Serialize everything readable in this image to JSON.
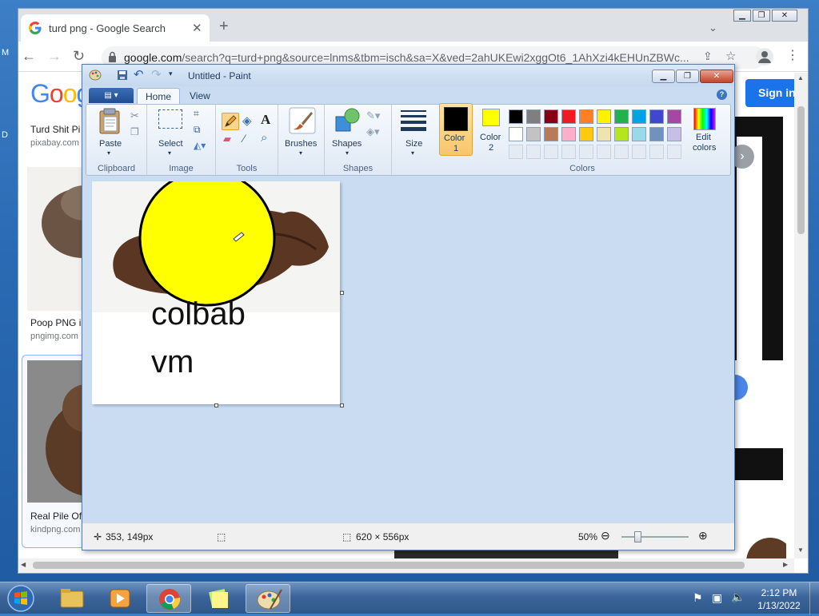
{
  "desktop": {
    "left_edge_letters": [
      "M",
      "D"
    ]
  },
  "chrome": {
    "tab_title": "turd png - Google Search",
    "url_host": "google.com",
    "url_path": "/search?q=turd+png&source=lnms&tbm=isch&sa=X&ved=2ahUKEwi2xggOt6_1AhXzi4kEHUnZBWc...",
    "sign_in": "Sign in",
    "results": [
      {
        "title": "Turd Shit Pi",
        "source": "pixabay.com"
      },
      {
        "title": "Poop PNG i",
        "source": "pngimg.com"
      },
      {
        "title": "Real Pile Of",
        "source": "kindpng.com"
      }
    ]
  },
  "paint": {
    "title": "Untitled - Paint",
    "tabs": [
      "Home",
      "View"
    ],
    "groups": {
      "clipboard": "Clipboard",
      "image": "Image",
      "tools": "Tools",
      "shapes": "Shapes",
      "colors": "Colors"
    },
    "buttons": {
      "paste": "Paste",
      "select": "Select",
      "brushes": "Brushes",
      "shapes": "Shapes",
      "size": "Size",
      "color1_line1": "Color",
      "color1_line2": "1",
      "color2_line1": "Color",
      "color2_line2": "2",
      "edit_colors_line1": "Edit",
      "edit_colors_line2": "colors"
    },
    "color1": "#000000",
    "color2": "#ffff00",
    "palette_row1": [
      "#000000",
      "#7f7f7f",
      "#880015",
      "#ed1c24",
      "#ff7f27",
      "#fff200",
      "#22b14c",
      "#00a2e8",
      "#3f48cc",
      "#a349a4"
    ],
    "palette_row2": [
      "#ffffff",
      "#c3c3c3",
      "#b97a57",
      "#ffaec9",
      "#ffc90e",
      "#efe4b0",
      "#b5e61d",
      "#99d9ea",
      "#7092be",
      "#c8bfe7"
    ],
    "canvas": {
      "text_line1": "colbab",
      "text_line2": "vm",
      "circle_fill": "#ffff00"
    },
    "status": {
      "cursor_pos": "353, 149px",
      "image_size": "620 × 556px",
      "zoom": "50%"
    }
  },
  "taskbar": {
    "time": "2:12 PM",
    "date": "1/13/2022"
  }
}
